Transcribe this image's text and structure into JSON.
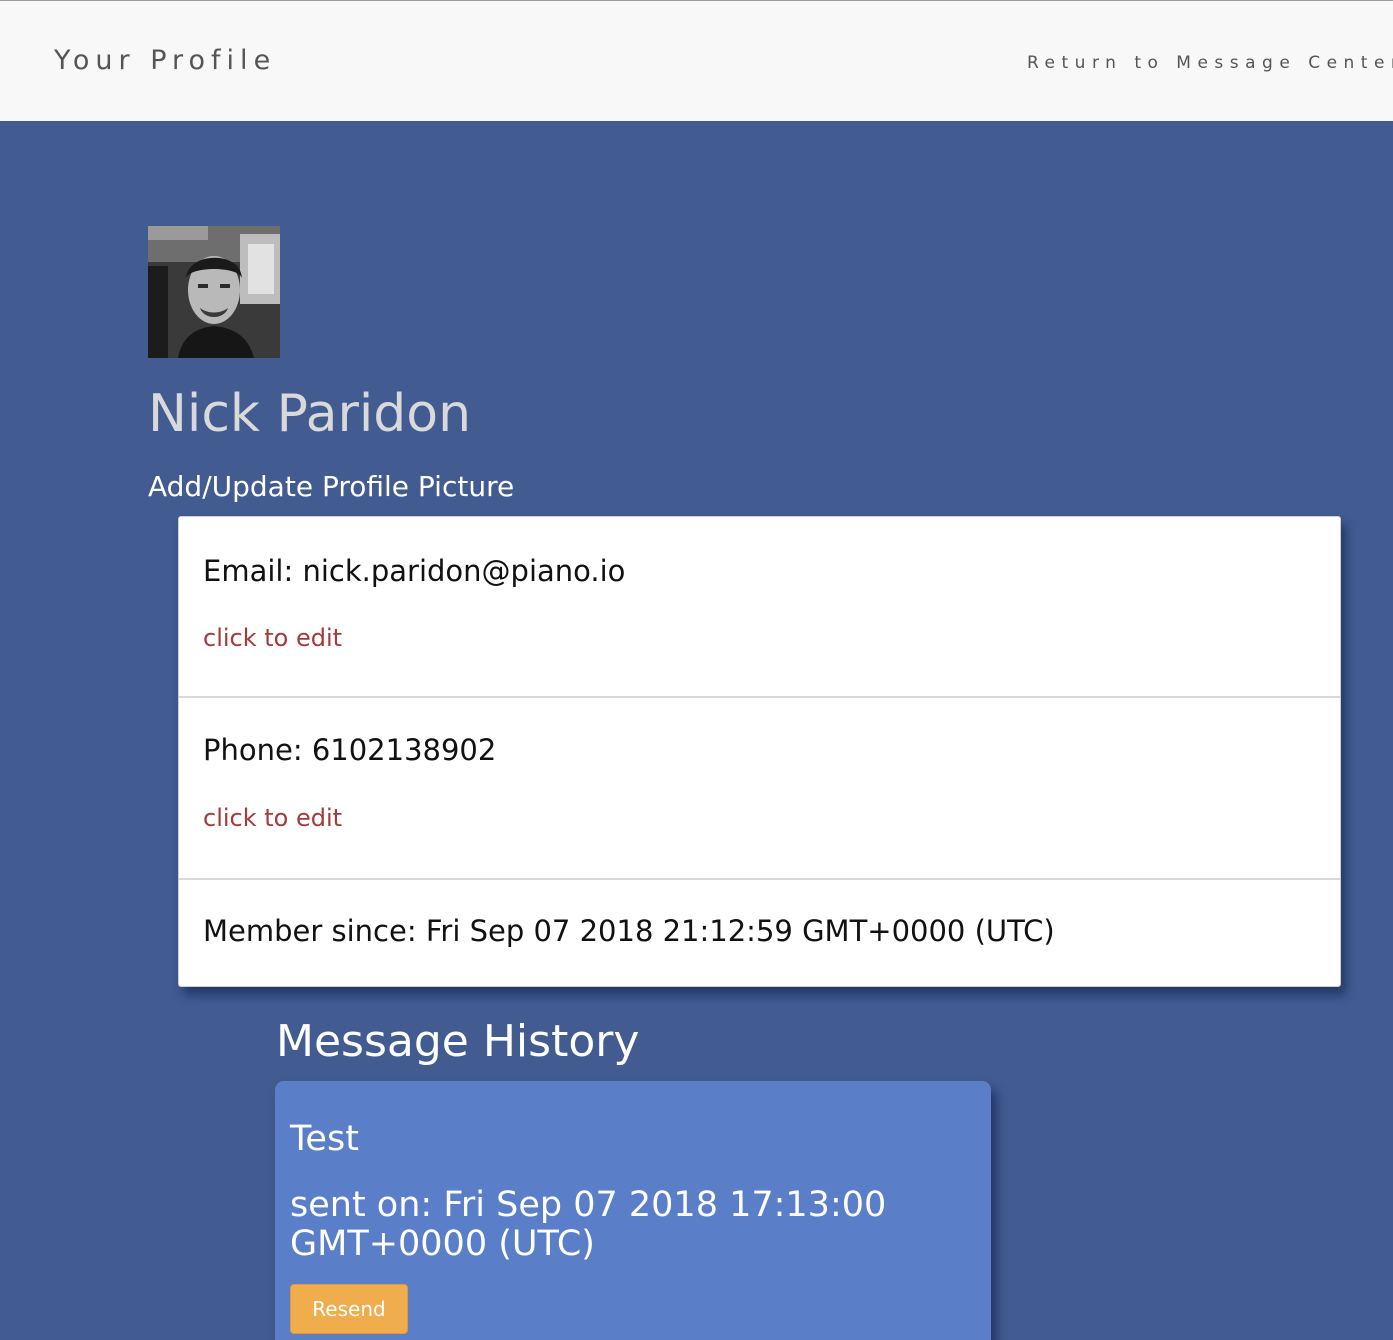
{
  "header": {
    "brand": "Your Profile",
    "return_link": "Return to Message Center"
  },
  "profile": {
    "avatar_icon": "user-photo",
    "name": "Nick Paridon",
    "update_picture_label": "Add/Update Profile Picture"
  },
  "info": {
    "email_line": "Email: nick.paridon@piano.io",
    "email_edit": "click to edit",
    "phone_line": "Phone: 6102138902",
    "phone_edit": "click to edit",
    "member_since_line": "Member since: Fri Sep 07 2018 21:12:59 GMT+0000 (UTC)"
  },
  "history": {
    "title": "Message History",
    "messages": [
      {
        "title": "Test",
        "sent_on": "sent on: Fri Sep 07 2018 17:13:00 GMT+0000 (UTC)",
        "resend_label": "Resend"
      }
    ]
  },
  "colors": {
    "page_background": "#425b91",
    "header_background": "#f8f8f8",
    "message_card": "#5a7fc8",
    "resend_button": "#f0ad4e",
    "edit_link": "#a33b3b"
  }
}
